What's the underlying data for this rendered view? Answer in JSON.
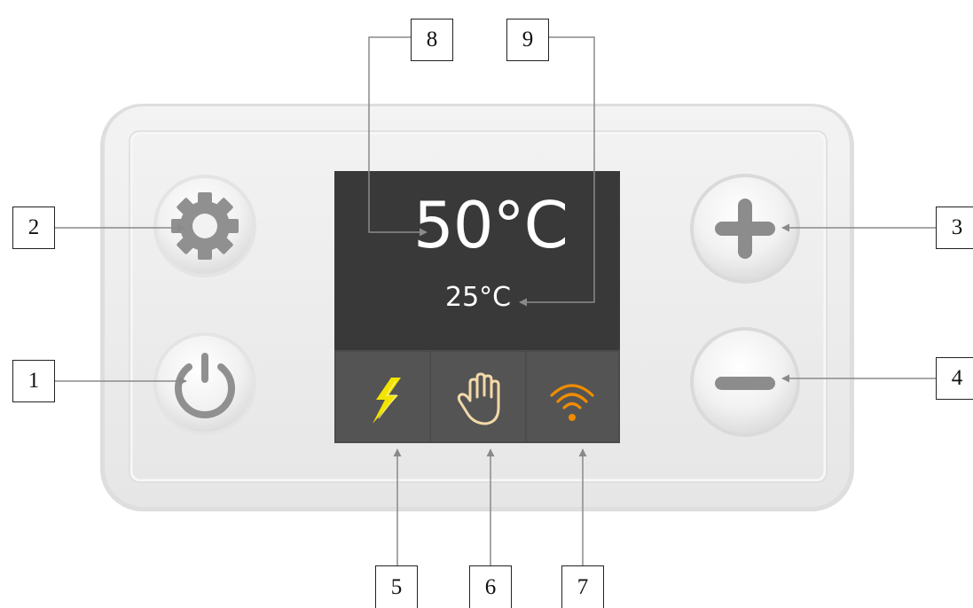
{
  "display": {
    "set_temperature": "50°C",
    "current_temperature": "25°C"
  },
  "buttons": [
    {
      "id": "power",
      "icon": "power-icon"
    },
    {
      "id": "settings",
      "icon": "gear-icon"
    },
    {
      "id": "increase",
      "icon": "plus-icon"
    },
    {
      "id": "decrease",
      "icon": "minus-icon"
    }
  ],
  "status_icons": [
    {
      "id": "power-mode",
      "icon": "lightning-bolt-icon",
      "color": "#f2e400"
    },
    {
      "id": "manual-mode",
      "icon": "hand-icon",
      "color": "#f3d9a9"
    },
    {
      "id": "wifi",
      "icon": "wifi-icon",
      "color": "#f08c00"
    }
  ],
  "callouts": {
    "c1": "1",
    "c2": "2",
    "c3": "3",
    "c4": "4",
    "c5": "5",
    "c6": "6",
    "c7": "7",
    "c8": "8",
    "c9": "9"
  },
  "colors": {
    "panel": "#ececec",
    "display_bg": "#3a3939",
    "status_bg": "#545454",
    "button_icon": "#909090",
    "leader_line": "#8a8a8a"
  }
}
